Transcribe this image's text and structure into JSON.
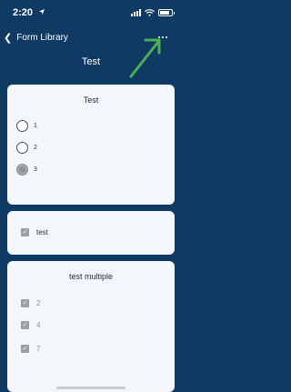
{
  "status_bar": {
    "time": "2:20"
  },
  "nav": {
    "back_label": "Form Library",
    "title": "Test"
  },
  "cards": {
    "radio_card": {
      "title": "Test",
      "options": [
        {
          "label": "1",
          "selected": false
        },
        {
          "label": "2",
          "selected": false
        },
        {
          "label": "3",
          "selected": true
        }
      ]
    },
    "single_check_card": {
      "label": "test",
      "checked": true
    },
    "multi_check_card": {
      "title": "test multiple",
      "options": [
        {
          "label": "2",
          "checked": true
        },
        {
          "label": "4",
          "checked": true
        },
        {
          "label": "7",
          "checked": true
        }
      ]
    }
  },
  "colors": {
    "background": "#0f3a63",
    "card": "#f3f6fa",
    "annotation_arrow": "#4caf50"
  }
}
